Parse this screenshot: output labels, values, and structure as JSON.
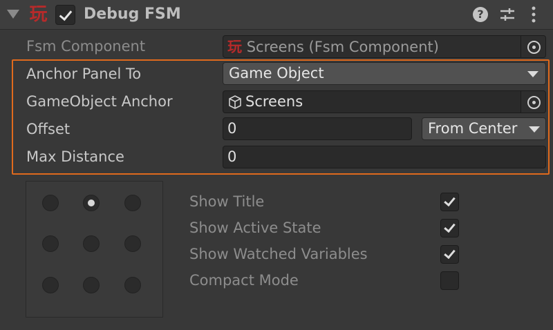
{
  "header": {
    "title": "Debug FSM",
    "logo_glyph": "玩",
    "enabled": true,
    "icons": [
      "foldout-arrow-icon",
      "playmaker-logo-icon",
      "help-icon",
      "presets-icon",
      "kebab-menu-icon"
    ]
  },
  "fields": {
    "fsm_component": {
      "label": "Fsm Component",
      "value": "Screens (Fsm Component)",
      "icon_glyph": "玩"
    },
    "anchor_panel_to": {
      "label": "Anchor Panel To",
      "value": "Game Object"
    },
    "gameobject_anchor": {
      "label": "GameObject Anchor",
      "value": "Screens"
    },
    "offset": {
      "label": "Offset",
      "value": "0",
      "mode": "From Center"
    },
    "max_distance": {
      "label": "Max Distance",
      "value": "0"
    }
  },
  "anchor_grid": {
    "rows": 3,
    "cols": 3,
    "selected": "top-center"
  },
  "options": [
    {
      "label": "Show Title",
      "checked": true
    },
    {
      "label": "Show Active State",
      "checked": true
    },
    {
      "label": "Show Watched Variables",
      "checked": true
    },
    {
      "label": "Compact Mode",
      "checked": false
    }
  ],
  "colors": {
    "highlight": "#e06a1d",
    "logo": "#b72a2a"
  }
}
